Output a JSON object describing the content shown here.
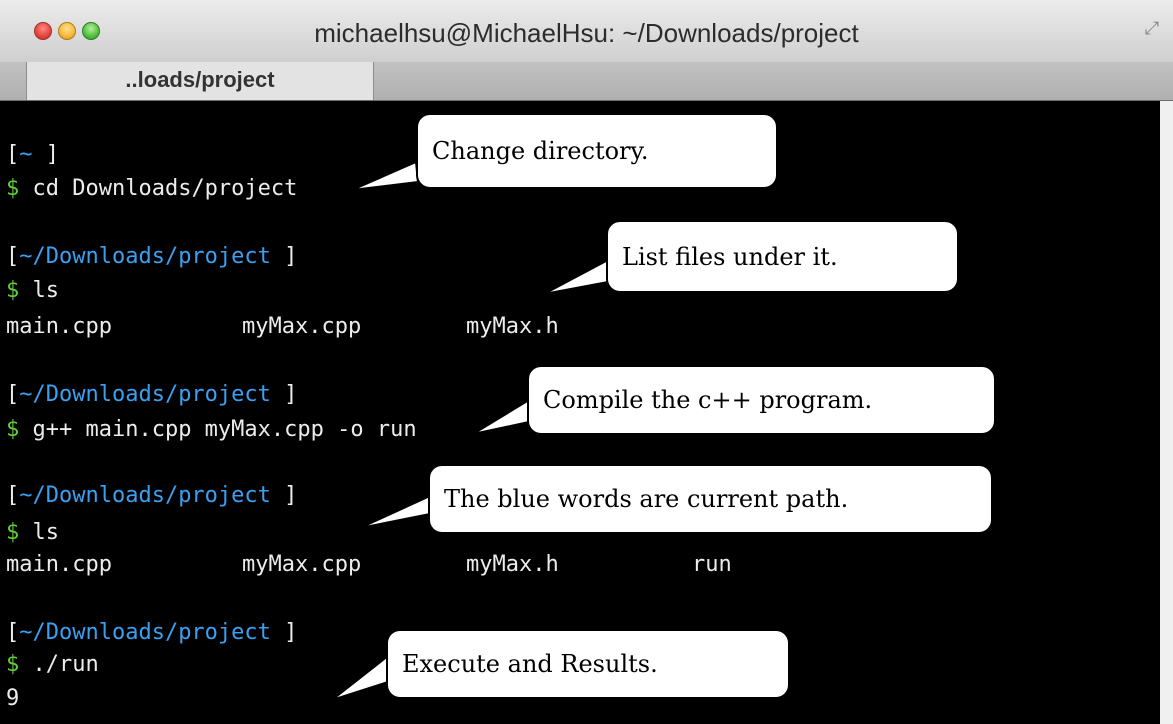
{
  "window": {
    "title": "michaelhsu@MichaelHsu: ~/Downloads/project",
    "tab": "..loads/project"
  },
  "terminal": {
    "blocks": [
      {
        "open": "[",
        "path": "~",
        "close": " ]",
        "dollar": "$",
        "command": "cd Downloads/project"
      },
      {
        "open": "[",
        "path": "~/Downloads/project",
        "close": " ]",
        "dollar": "$",
        "command": "ls",
        "output": [
          "main.cpp",
          "myMax.cpp",
          "myMax.h"
        ]
      },
      {
        "open": "[",
        "path": "~/Downloads/project",
        "close": " ]",
        "dollar": "$",
        "command": "g++ main.cpp myMax.cpp -o run"
      },
      {
        "open": "[",
        "path": "~/Downloads/project",
        "close": " ]",
        "dollar": "$",
        "command": "ls",
        "output": [
          "main.cpp",
          "myMax.cpp",
          "myMax.h",
          "run"
        ]
      },
      {
        "open": "[",
        "path": "~/Downloads/project",
        "close": " ]",
        "dollar": "$",
        "command": "./run",
        "output_text": "9"
      }
    ]
  },
  "callouts": [
    "Change directory.",
    "List files under it.",
    "Compile the c++ program.",
    "The blue words are current path.",
    "Execute and Results."
  ],
  "colors": {
    "path": "#3aa0f2",
    "prompt_dollar": "#5fcf3b",
    "text": "#ececec",
    "background": "#000000"
  }
}
